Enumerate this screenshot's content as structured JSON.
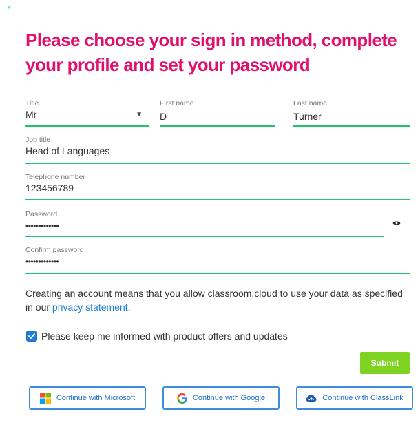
{
  "heading": "Please choose your sign in method, complete your profile and set your password",
  "fields": {
    "title": {
      "label": "Title",
      "value": "Mr"
    },
    "first_name": {
      "label": "First name",
      "value": "D"
    },
    "last_name": {
      "label": "Last name",
      "value": "Turner"
    },
    "job_title": {
      "label": "Job title",
      "value": "Head of Languages"
    },
    "telephone": {
      "label": "Telephone number",
      "value": "123456789"
    },
    "password": {
      "label": "Password",
      "value": "•••••••••••••"
    },
    "confirm_password": {
      "label": "Confirm password",
      "value": "•••••••••••••"
    }
  },
  "consent": {
    "text": "Creating an account means that you allow classroom.cloud to use your data as specified in our ",
    "link": "privacy statement",
    "suffix": "."
  },
  "updates_checkbox": {
    "label": "Please keep me informed with product offers and updates",
    "checked": true
  },
  "submit_label": "Submit",
  "sso": {
    "microsoft": "Continue with Microsoft",
    "google": "Continue with Google",
    "classlink": "Continue with ClassLink"
  },
  "colors": {
    "heading": "#e0116d",
    "underline": "#1fc46c",
    "submit": "#7ed321",
    "link": "#1f7fd6",
    "sso_border": "#3e8ee0"
  }
}
